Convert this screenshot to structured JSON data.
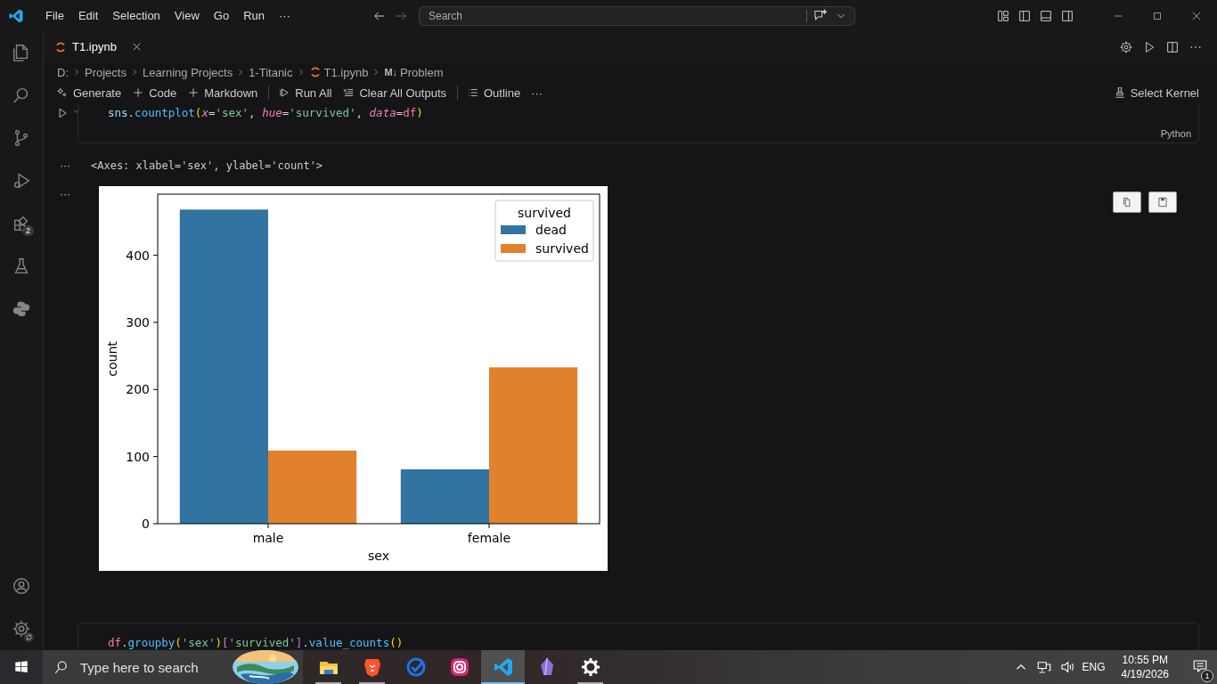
{
  "title_bar": {
    "menu": [
      "File",
      "Edit",
      "Selection",
      "View",
      "Go",
      "Run",
      "···"
    ],
    "search": {
      "placeholder": "Search"
    }
  },
  "activity_bar": {
    "items": [
      {
        "kind": "files"
      },
      {
        "kind": "search"
      },
      {
        "kind": "branch"
      },
      {
        "kind": "debug"
      },
      {
        "kind": "extensions",
        "badge": "2"
      },
      {
        "kind": "flask"
      },
      {
        "kind": "python"
      }
    ],
    "bottom": [
      {
        "kind": "account"
      },
      {
        "kind": "gear"
      }
    ]
  },
  "tabs": [
    {
      "label": "T1.ipynb",
      "selected": true
    }
  ],
  "breadcrumbs": [
    {
      "label": "D:"
    },
    {
      "label": "Projects"
    },
    {
      "label": "Learning Projects"
    },
    {
      "label": "1-Titanic"
    },
    {
      "label": "T1.ipynb",
      "kind": "notebook"
    },
    {
      "label": "Problem",
      "kind": "markdown",
      "glyph": "M↓"
    }
  ],
  "toolbar": {
    "groups": [
      [
        {
          "kind": "sparkle",
          "label": "Generate"
        },
        {
          "kind": "plus",
          "label": "Code"
        },
        {
          "kind": "plus",
          "label": "Markdown"
        }
      ],
      [
        {
          "kind": "runall",
          "label": "Run All"
        },
        {
          "kind": "clear",
          "label": "Clear All Outputs"
        }
      ],
      [
        {
          "kind": "list",
          "label": "Outline"
        },
        {
          "kind": "more",
          "label": "···"
        }
      ]
    ],
    "kernel": "Select Kernel"
  },
  "cells": [
    {
      "language": "Python",
      "code": [
        {
          "kind": "var",
          "text": "sns"
        },
        {
          "kind": "punct",
          "text": "."
        },
        {
          "kind": "func",
          "text": "countplot"
        },
        {
          "kind": "paren",
          "text": "("
        },
        {
          "kind": "param",
          "text": "x"
        },
        {
          "kind": "op",
          "text": "="
        },
        {
          "kind": "str",
          "text": "'sex'"
        },
        {
          "kind": "punct",
          "text": ", "
        },
        {
          "kind": "param",
          "text": "hue"
        },
        {
          "kind": "op",
          "text": "="
        },
        {
          "kind": "str",
          "text": "'survived'"
        },
        {
          "kind": "punct",
          "text": ", "
        },
        {
          "kind": "param",
          "text": "data"
        },
        {
          "kind": "op",
          "text": "="
        },
        {
          "kind": "ident",
          "text": "df"
        },
        {
          "kind": "paren",
          "text": ")"
        }
      ],
      "outputs": [
        {
          "kind": "text",
          "marker": "···",
          "text": "<Axes: xlabel='sex', ylabel='count'>"
        },
        {
          "kind": "plot",
          "marker": "···",
          "chart_data": {
            "type": "bar",
            "xlabel": "sex",
            "ylabel": "count",
            "categories": [
              "male",
              "female"
            ],
            "series": [
              {
                "name": "dead",
                "color": "#3274a1",
                "values": [
                  468,
                  81
                ]
              },
              {
                "name": "survived",
                "color": "#e1812c",
                "values": [
                  109,
                  233
                ]
              }
            ],
            "ylim": [
              0,
              491
            ],
            "yticks": [
              0,
              100,
              200,
              300,
              400
            ],
            "legend": {
              "title": "survived"
            }
          }
        }
      ]
    },
    {
      "code": [
        {
          "kind": "ident",
          "text": "df"
        },
        {
          "kind": "punct",
          "text": "."
        },
        {
          "kind": "func",
          "text": "groupby"
        },
        {
          "kind": "paren",
          "text": "("
        },
        {
          "kind": "str",
          "text": "'sex'"
        },
        {
          "kind": "paren",
          "text": ")"
        },
        {
          "kind": "bracket",
          "text": "["
        },
        {
          "kind": "str",
          "text": "'survived'"
        },
        {
          "kind": "bracket",
          "text": "]"
        },
        {
          "kind": "punct",
          "text": "."
        },
        {
          "kind": "func",
          "text": "value_counts"
        },
        {
          "kind": "paren",
          "text": "()"
        }
      ]
    }
  ],
  "taskbar": {
    "search": {
      "placeholder": "Type here to search"
    },
    "apps": [
      {
        "kind": "folder",
        "selected": false,
        "running": true
      },
      {
        "kind": "lion",
        "selected": false,
        "running": true
      },
      {
        "kind": "check",
        "selected": false,
        "running": false
      },
      {
        "kind": "camera",
        "selected": false,
        "running": false
      },
      {
        "kind": "vscode",
        "selected": true,
        "running": true
      },
      {
        "kind": "crystal",
        "selected": false,
        "running": false
      },
      {
        "kind": "gear",
        "selected": false,
        "running": true
      }
    ],
    "language": "ENG",
    "time": "10:55 PM",
    "date": "4/19/2026",
    "notifications": "1"
  }
}
